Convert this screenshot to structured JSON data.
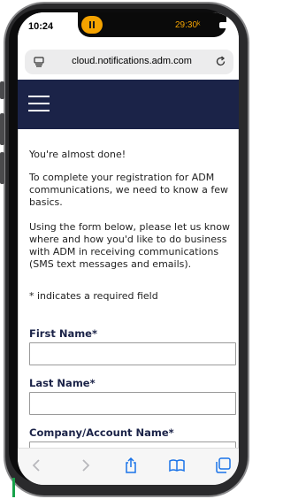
{
  "status_bar": {
    "time": "10:24",
    "timer": "29:30ᵏ"
  },
  "browser": {
    "url": "cloud.notifications.adm.com"
  },
  "page": {
    "intro_1": "You're almost done!",
    "intro_2": "To complete your registration for ADM communications, we need to know a few basics.",
    "intro_3": "Using the form below, please let us know where and how you'd like to do business with ADM in receiving communications (SMS text messages and emails).",
    "required_note": "* indicates a required field"
  },
  "form": {
    "first_name_label": "First Name*",
    "first_name_value": "",
    "last_name_label": "Last Name*",
    "last_name_value": "",
    "company_label": "Company/Account Name*",
    "company_value": ""
  },
  "colors": {
    "header_bg": "#1b2348",
    "label_color": "#1b2348",
    "timer_color": "#f5a300"
  },
  "icons": {
    "back": "chevron-left-icon",
    "forward": "chevron-right-icon",
    "share": "share-icon",
    "bookmarks": "book-icon",
    "tabs": "tabs-icon",
    "menu": "hamburger-icon",
    "reload": "reload-icon"
  }
}
